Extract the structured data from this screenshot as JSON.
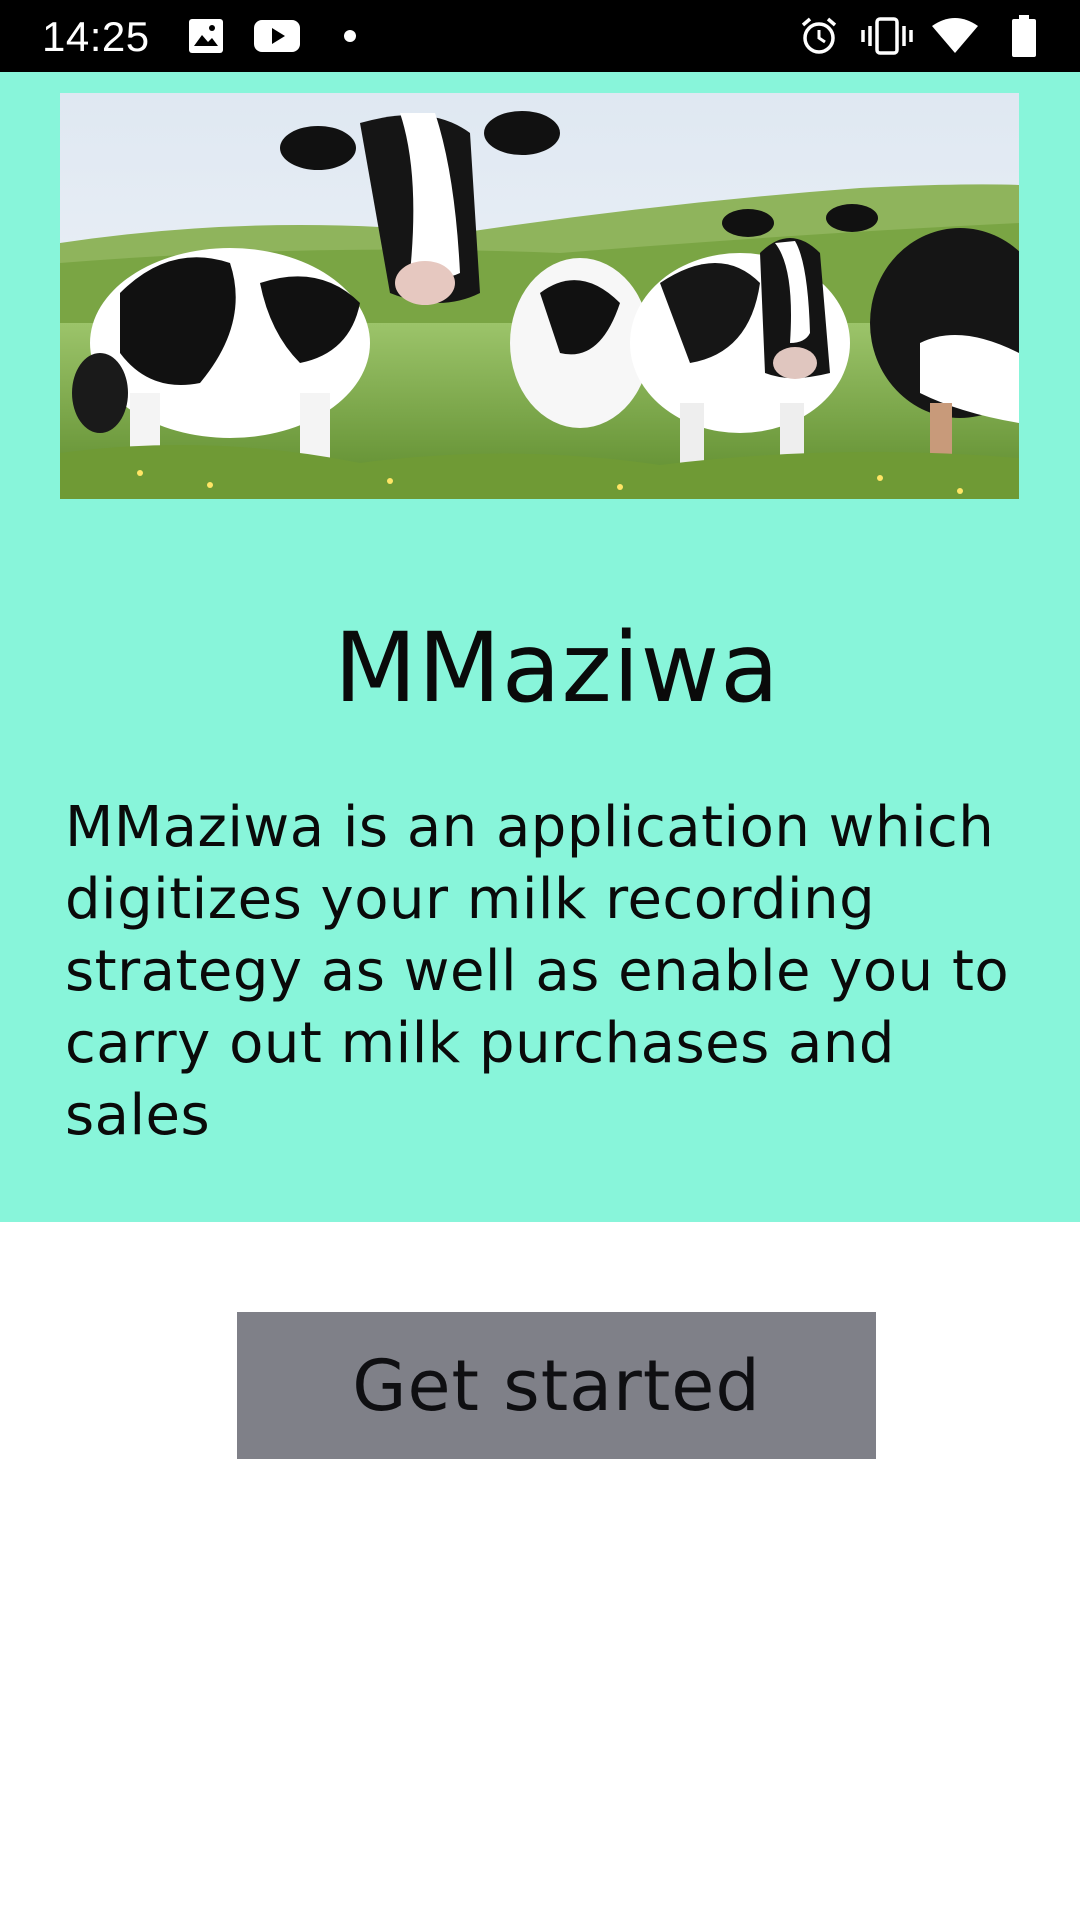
{
  "status_bar": {
    "time": "14:25",
    "left_icons": [
      "image-icon",
      "youtube-icon",
      "dot-icon"
    ],
    "right_icons": [
      "alarm-icon",
      "vibrate-icon",
      "wifi-icon",
      "battery-icon"
    ]
  },
  "hero": {
    "background": "#88f5da",
    "image": "cows-in-pasture-image"
  },
  "app": {
    "title": "MMaziwa",
    "description": "MMaziwa is an application which digitizes your milk recording strategy as well as enable you to carry out milk purchases and sales"
  },
  "actions": {
    "get_started_label": "Get started",
    "button_color": "#7f8088"
  }
}
